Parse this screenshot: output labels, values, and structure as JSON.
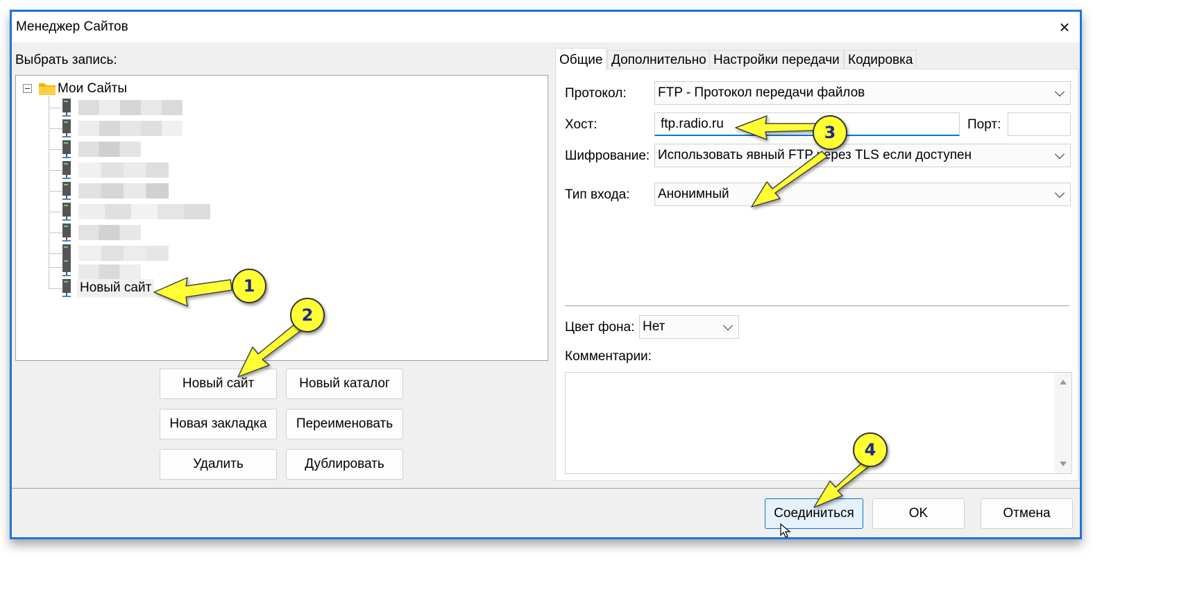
{
  "window": {
    "title": "Менеджер Сайтов",
    "close_icon": "×"
  },
  "left": {
    "select_label": "Выбрать запись:",
    "tree": {
      "root_label": "Мои Сайты",
      "selected_item": "Новый сайт"
    },
    "buttons": {
      "new_site": "Новый сайт",
      "new_folder": "Новый каталог",
      "new_bookmark": "Новая закладка",
      "rename": "Переименовать",
      "delete": "Удалить",
      "duplicate": "Дублировать"
    }
  },
  "tabs": [
    "Общие",
    "Дополнительно",
    "Настройки передачи",
    "Кодировка"
  ],
  "general": {
    "protocol_label": "Протокол:",
    "protocol_value": "FTP - Протокол передачи файлов",
    "host_label": "Хост:",
    "host_value": "ftp.radio.ru",
    "port_label": "Порт:",
    "port_value": "",
    "encryption_label": "Шифрование:",
    "encryption_value": "Использовать явный FTP через TLS если доступен",
    "logon_label": "Тип входа:",
    "logon_value": "Анонимный",
    "bgcolor_label": "Цвет фона:",
    "bgcolor_value": "Нет",
    "comments_label": "Комментарии:"
  },
  "footer": {
    "connect": "Соединиться",
    "ok": "OK",
    "cancel": "Отмена"
  },
  "annotations": [
    "1",
    "2",
    "3",
    "4"
  ],
  "colors": {
    "accent": "#1e74d8",
    "callout": "#ffff33",
    "callout_text": "#1c2a88"
  }
}
